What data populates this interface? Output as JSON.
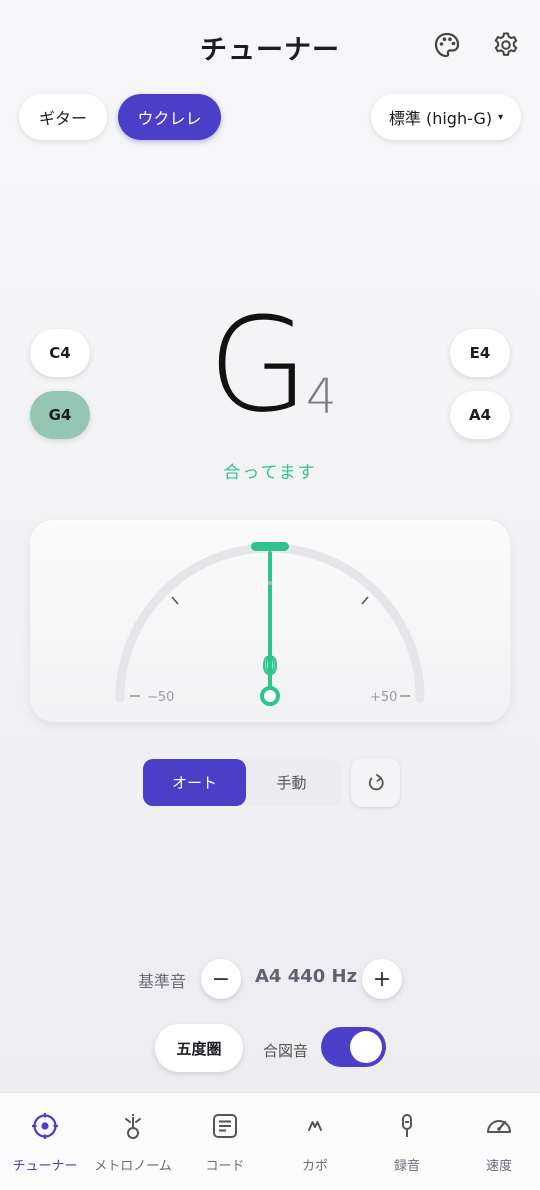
{
  "header": {
    "title": "チューナー",
    "icons": [
      "palette-icon",
      "gear-icon"
    ]
  },
  "instruments": [
    {
      "label": "ギター",
      "active": false
    },
    {
      "label": "ウクレレ",
      "active": true
    }
  ],
  "tuning_select": {
    "value": "標準 (high-G)",
    "caret": "▾"
  },
  "note": {
    "letter": "G",
    "octave": "4"
  },
  "strings_left": [
    {
      "label": "C4",
      "active": false
    },
    {
      "label": "G4",
      "active": true
    }
  ],
  "strings_right": [
    {
      "label": "E4",
      "active": false
    },
    {
      "label": "A4",
      "active": false
    }
  ],
  "status": "合ってます",
  "meter": {
    "min_label": "−50",
    "max_label": "+50",
    "cents": 0,
    "needle_label": "0"
  },
  "mode": {
    "auto": "オート",
    "manual": "手動",
    "selected": "auto"
  },
  "reference": {
    "label": "基準音",
    "value": "A4 440 Hz",
    "minus": "−",
    "plus": "+"
  },
  "circle_of_fifths": "五度圏",
  "signal": {
    "label": "合図音",
    "on": true
  },
  "nav": [
    {
      "label": "チューナー",
      "icon": "tuner-icon",
      "active": true
    },
    {
      "label": "メトロノーム",
      "icon": "metronome-icon",
      "active": false
    },
    {
      "label": "コード",
      "icon": "chord-icon",
      "active": false
    },
    {
      "label": "カポ",
      "icon": "capo-icon",
      "active": false
    },
    {
      "label": "録音",
      "icon": "mic-icon",
      "active": false
    },
    {
      "label": "速度",
      "icon": "speed-icon",
      "active": false
    }
  ],
  "colors": {
    "accent": "#4a3fc6",
    "in_tune": "#2fc48d",
    "active_string": "#94c6b3"
  }
}
